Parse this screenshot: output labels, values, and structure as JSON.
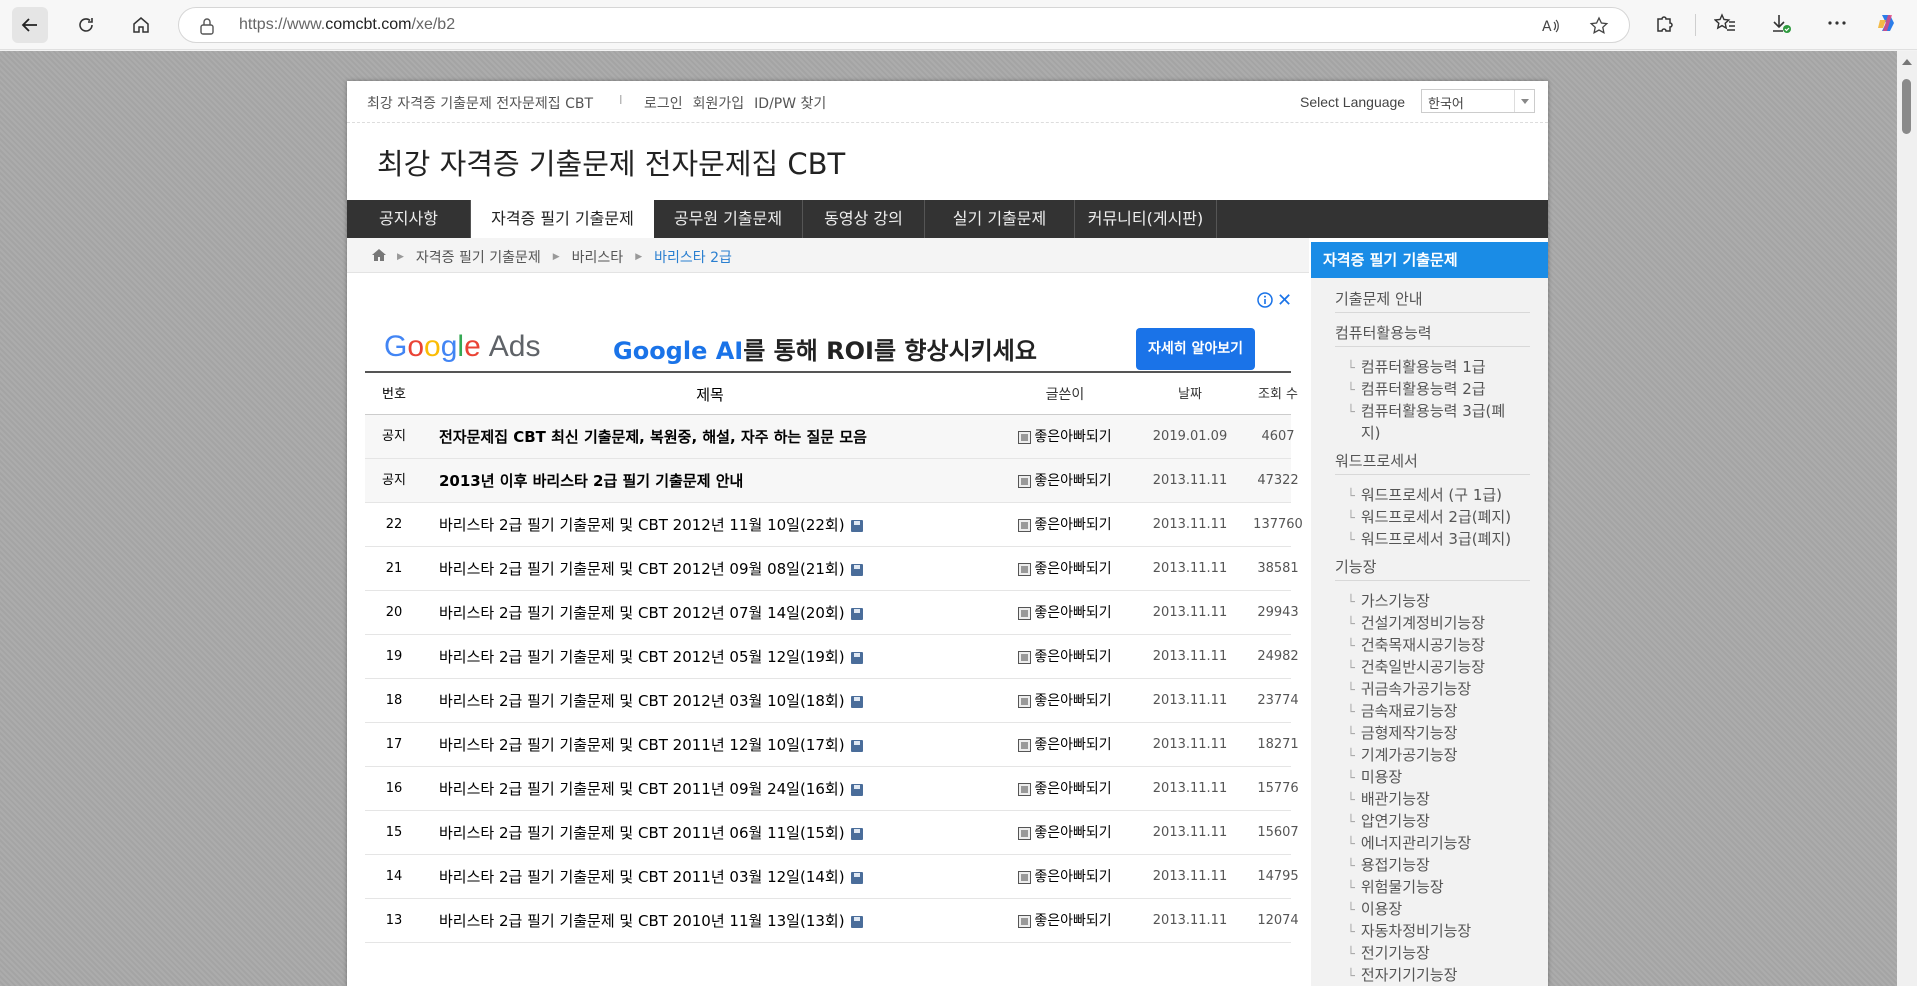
{
  "browser": {
    "url_prefix": "https://www.",
    "url_domain": "comcbt.com",
    "url_path": "/xe/b2"
  },
  "topbar": {
    "site_name": "최강 자격증 기출문제 전자문제집 CBT",
    "divider": "I",
    "login": "로그인",
    "signup": "회원가입",
    "find_idpw": "ID/PW 찾기",
    "language_label": "Select Language",
    "language_value": "한국어"
  },
  "site_title": "최강 자격증 기출문제 전자문제집 CBT",
  "nav": [
    {
      "label": "공지사항"
    },
    {
      "label": "자격증 필기 기출문제"
    },
    {
      "label": "공무원 기출문제"
    },
    {
      "label": "동영상 강의"
    },
    {
      "label": "실기 기출문제"
    },
    {
      "label": "커뮤니티(게시판)"
    }
  ],
  "breadcrumb": {
    "level1": "자격증 필기 기출문제",
    "level2": "바리스타",
    "current": "바리스타 2급"
  },
  "ad": {
    "brand_g": "G",
    "brand_o1": "o",
    "brand_o2": "o",
    "brand_g2": "g",
    "brand_l": "l",
    "brand_e": "e",
    "brand_ads": "Ads",
    "headline_highlight": "Google AI",
    "headline_rest": "를 통해 ROI를 향상시키세요",
    "cta": "자세히 알아보기"
  },
  "table": {
    "headers": {
      "no": "번호",
      "title": "제목",
      "author": "글쓴이",
      "date": "날짜",
      "views": "조회 수"
    },
    "rows": [
      {
        "no": "공지",
        "title": "전자문제집 CBT 최신 기출문제, 복원중, 해설, 자주 하는 질문 모음",
        "author": "좋은아빠되기",
        "date": "2019.01.09",
        "views": "4607"
      },
      {
        "no": "공지",
        "title": "2013년 이후 바리스타 2급 필기 기출문제 안내",
        "author": "좋은아빠되기",
        "date": "2013.11.11",
        "views": "47322"
      },
      {
        "no": "22",
        "title": "바리스타 2급 필기 기출문제 및 CBT 2012년 11월 10일(22회)",
        "author": "좋은아빠되기",
        "date": "2013.11.11",
        "views": "137760"
      },
      {
        "no": "21",
        "title": "바리스타 2급 필기 기출문제 및 CBT 2012년 09월 08일(21회)",
        "author": "좋은아빠되기",
        "date": "2013.11.11",
        "views": "38581"
      },
      {
        "no": "20",
        "title": "바리스타 2급 필기 기출문제 및 CBT 2012년 07월 14일(20회)",
        "author": "좋은아빠되기",
        "date": "2013.11.11",
        "views": "29943"
      },
      {
        "no": "19",
        "title": "바리스타 2급 필기 기출문제 및 CBT 2012년 05월 12일(19회)",
        "author": "좋은아빠되기",
        "date": "2013.11.11",
        "views": "24982"
      },
      {
        "no": "18",
        "title": "바리스타 2급 필기 기출문제 및 CBT 2012년 03월 10일(18회)",
        "author": "좋은아빠되기",
        "date": "2013.11.11",
        "views": "23774"
      },
      {
        "no": "17",
        "title": "바리스타 2급 필기 기출문제 및 CBT 2011년 12월 10일(17회)",
        "author": "좋은아빠되기",
        "date": "2013.11.11",
        "views": "18271"
      },
      {
        "no": "16",
        "title": "바리스타 2급 필기 기출문제 및 CBT 2011년 09월 24일(16회)",
        "author": "좋은아빠되기",
        "date": "2013.11.11",
        "views": "15776"
      },
      {
        "no": "15",
        "title": "바리스타 2급 필기 기출문제 및 CBT 2011년 06월 11일(15회)",
        "author": "좋은아빠되기",
        "date": "2013.11.11",
        "views": "15607"
      },
      {
        "no": "14",
        "title": "바리스타 2급 필기 기출문제 및 CBT 2011년 03월 12일(14회)",
        "author": "좋은아빠되기",
        "date": "2013.11.11",
        "views": "14795"
      },
      {
        "no": "13",
        "title": "바리스타 2급 필기 기출문제 및 CBT 2010년 11월 13일(13회)",
        "author": "좋은아빠되기",
        "date": "2013.11.11",
        "views": "12074"
      }
    ]
  },
  "sidebar": {
    "heading": "자격증 필기 기출문제",
    "guide": "기출문제 안내",
    "sec1": "컴퓨터활용능력",
    "sec1_items": [
      "컴퓨터활용능력 1급",
      "컴퓨터활용능력 2급",
      "컴퓨터활용능력 3급(폐",
      "지)"
    ],
    "sec2": "워드프로세서",
    "sec2_items": [
      "워드프로세서 (구 1급)",
      "워드프로세서 2급(폐지)",
      "워드프로세서 3급(폐지)"
    ],
    "sec3": "기능장",
    "sec3_items": [
      "가스기능장",
      "건설기계정비기능장",
      "건축목재시공기능장",
      "건축일반시공기능장",
      "귀금속가공기능장",
      "금속재료기능장",
      "금형제작기능장",
      "기계가공기능장",
      "미용장",
      "배관기능장",
      "압연기능장",
      "에너지관리기능장",
      "용접기능장",
      "위험물기능장",
      "이용장",
      "자동차정비기능장",
      "전기기능장",
      "전자기기기능장"
    ]
  }
}
